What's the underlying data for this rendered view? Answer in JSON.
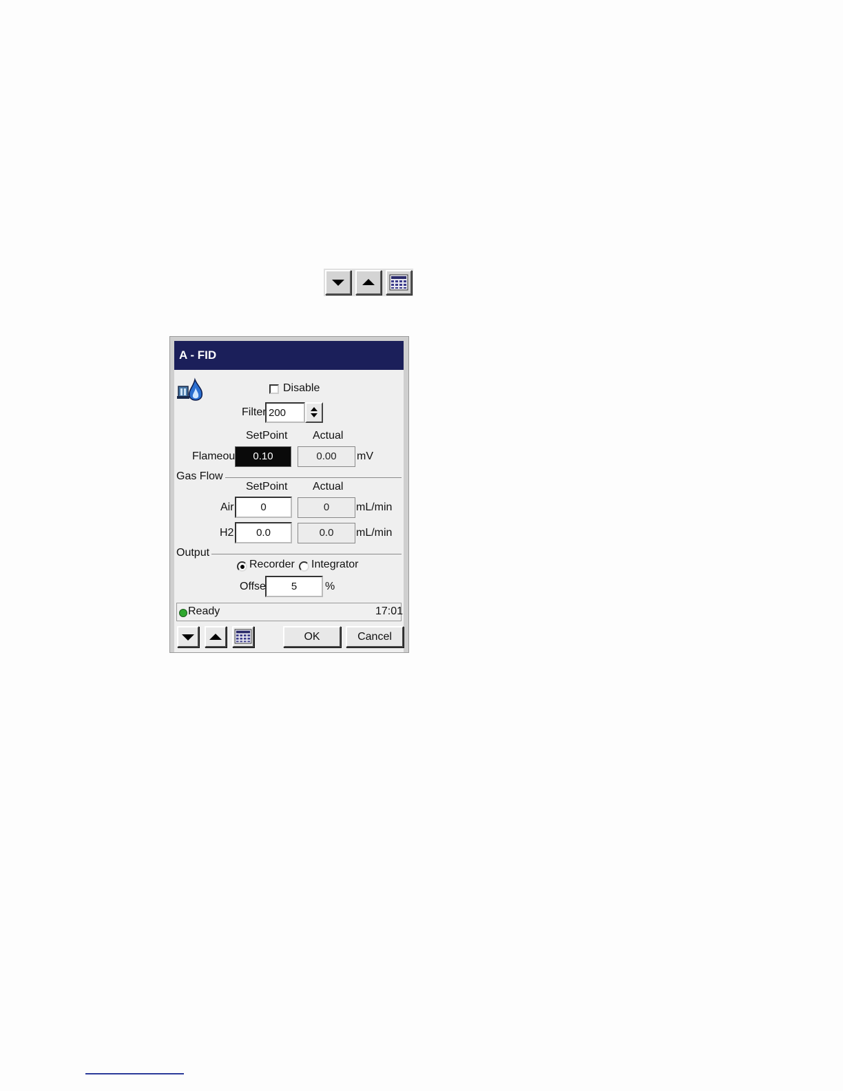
{
  "toolbar": {
    "down_icon": "arrow-down-icon",
    "up_icon": "arrow-up-icon",
    "keypad_icon": "keypad-icon"
  },
  "dialog": {
    "title": "A - FID",
    "detector_icon": "flame-detector-icon",
    "disable_label": "Disable",
    "disable_checked": false,
    "filter_label": "Filter",
    "filter_value": "200",
    "setpoint_header": "SetPoint",
    "actual_header": "Actual",
    "flameout": {
      "label": "Flameout",
      "setpoint": "0.10",
      "actual": "0.00",
      "unit": "mV"
    },
    "gas_flow": {
      "section_label": "Gas Flow",
      "setpoint_header": "SetPoint",
      "actual_header": "Actual",
      "rows": [
        {
          "label": "Air",
          "setpoint": "0",
          "actual": "0",
          "unit": "mL/min"
        },
        {
          "label": "H2",
          "setpoint": "0.0",
          "actual": "0.0",
          "unit": "mL/min"
        }
      ]
    },
    "output": {
      "section_label": "Output",
      "options": [
        "Recorder",
        "Integrator"
      ],
      "selected": "Recorder",
      "offset_label": "Offset",
      "offset_value": "5",
      "offset_unit": "%"
    },
    "status": {
      "text": "Ready",
      "time": "17:01",
      "indicator_color": "#2fa82f"
    },
    "buttons": {
      "ok": "OK",
      "cancel": "Cancel"
    }
  }
}
